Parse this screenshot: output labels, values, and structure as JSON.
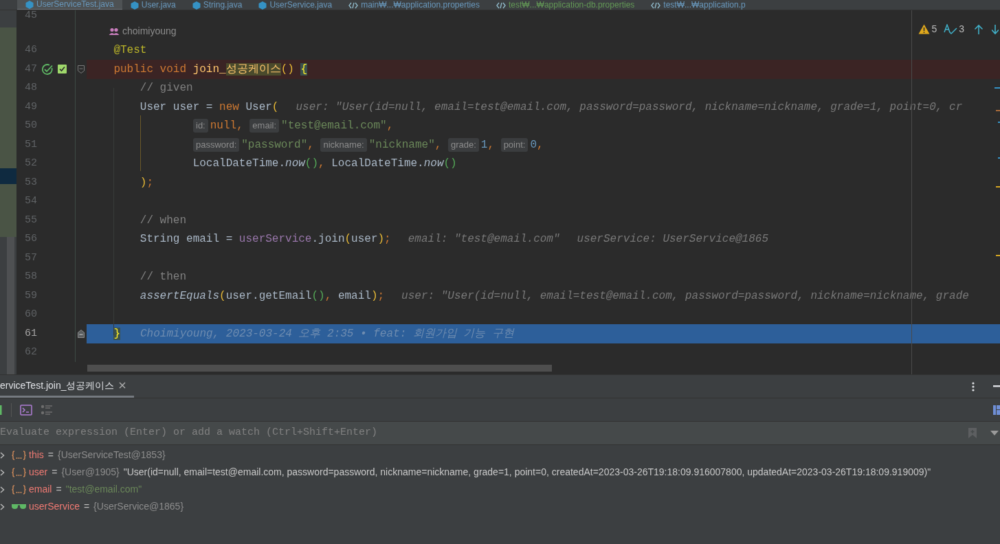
{
  "tabs": [
    {
      "label": "UserServiceTest.java",
      "kind": "java",
      "color": "#6897bb",
      "selected": true
    },
    {
      "label": "User.java",
      "kind": "java",
      "color": "#6897bb",
      "selected": false
    },
    {
      "label": "String.java",
      "kind": "java",
      "color": "#6897bb",
      "selected": false
    },
    {
      "label": "UserService.java",
      "kind": "java",
      "color": "#6897bb",
      "selected": false
    },
    {
      "label": "main₩...₩application.properties",
      "kind": "properties",
      "color": "#6897bb",
      "selected": false
    },
    {
      "label": "test₩...₩application-db.properties",
      "kind": "properties",
      "color": "#629755",
      "selected": false
    },
    {
      "label": "test₩...₩application.p",
      "kind": "properties",
      "color": "#6897bb",
      "selected": false
    }
  ],
  "inspections": {
    "warnings": "5",
    "typos": "3"
  },
  "lines": [
    {
      "kind": "code",
      "number": "45"
    },
    {
      "kind": "author",
      "text": "choimiyoung"
    },
    {
      "kind": "code",
      "number": "46",
      "tokens": [
        {
          "kind": "annotation",
          "text": "    @Test"
        }
      ]
    },
    {
      "kind": "test_header",
      "number": "47",
      "tokens": [
        {
          "kind": "keyword",
          "text": "    public void "
        },
        {
          "kind": "method",
          "text": "join_"
        },
        {
          "kind": "method_hl",
          "text": "성공케이스"
        },
        {
          "kind": "bracket1",
          "text": "() "
        },
        {
          "kind": "brace_match",
          "text": "{"
        }
      ]
    },
    {
      "kind": "code",
      "number": "48",
      "tokens": [
        {
          "kind": "comment",
          "text": "        // given"
        }
      ]
    },
    {
      "kind": "code",
      "number": "49",
      "tokens": [
        {
          "kind": "plain",
          "text": "        User user = "
        },
        {
          "kind": "keyword",
          "text": "new"
        },
        {
          "kind": "plain",
          "text": " User"
        },
        {
          "kind": "bracket1",
          "text": "("
        },
        {
          "kind": "hint",
          "text": "user: \"User(id=null, email=test@email.com, password=password, nickname=nickname, grade=1, point=0, cr"
        }
      ]
    },
    {
      "kind": "code",
      "number": "50",
      "tokens": [
        {
          "kind": "param",
          "text": "id:"
        },
        {
          "kind": "keyword",
          "text": "null"
        },
        {
          "kind": "punct",
          "text": ", "
        },
        {
          "kind": "param",
          "text": "email:"
        },
        {
          "kind": "string",
          "text": "\"test@email.com\""
        },
        {
          "kind": "punct",
          "text": ","
        }
      ]
    },
    {
      "kind": "code",
      "number": "51",
      "tokens": [
        {
          "kind": "param",
          "text": "password:"
        },
        {
          "kind": "string",
          "text": "\"password\""
        },
        {
          "kind": "punct",
          "text": ", "
        },
        {
          "kind": "param",
          "text": "nickname:"
        },
        {
          "kind": "string",
          "text": "\"nickname\""
        },
        {
          "kind": "punct",
          "text": ", "
        },
        {
          "kind": "param",
          "text": "grade:"
        },
        {
          "kind": "number",
          "text": "1"
        },
        {
          "kind": "punct",
          "text": ", "
        },
        {
          "kind": "param",
          "text": "point:"
        },
        {
          "kind": "number",
          "text": "0"
        },
        {
          "kind": "punct",
          "text": ","
        }
      ]
    },
    {
      "kind": "code",
      "number": "52",
      "tokens": [
        {
          "kind": "plain",
          "text": "                LocalDateTime."
        },
        {
          "kind": "static",
          "text": "now"
        },
        {
          "kind": "bracket2",
          "text": "()"
        },
        {
          "kind": "punct",
          "text": ", "
        },
        {
          "kind": "plain",
          "text": "LocalDateTime."
        },
        {
          "kind": "static",
          "text": "now"
        },
        {
          "kind": "bracket2",
          "text": "()"
        }
      ]
    },
    {
      "kind": "code",
      "number": "53",
      "tokens": [
        {
          "kind": "bracket1",
          "text": "        )"
        },
        {
          "kind": "punct",
          "text": ";"
        }
      ]
    },
    {
      "kind": "code",
      "number": "54"
    },
    {
      "kind": "code",
      "number": "55",
      "tokens": [
        {
          "kind": "comment",
          "text": "        // when"
        }
      ]
    },
    {
      "kind": "code",
      "number": "56",
      "tokens": [
        {
          "kind": "plain",
          "text": "        String email = "
        },
        {
          "kind": "field",
          "text": "userService"
        },
        {
          "kind": "plain",
          "text": ".join"
        },
        {
          "kind": "bracket1",
          "text": "("
        },
        {
          "kind": "plain",
          "text": "user"
        },
        {
          "kind": "bracket1",
          "text": ")"
        },
        {
          "kind": "punct",
          "text": ";"
        },
        {
          "kind": "hint",
          "text": "email: \"test@email.com\""
        },
        {
          "kind": "hint",
          "text": "userService: UserService@1865"
        }
      ]
    },
    {
      "kind": "code",
      "number": "57"
    },
    {
      "kind": "code",
      "number": "58",
      "tokens": [
        {
          "kind": "comment",
          "text": "        // then"
        }
      ]
    },
    {
      "kind": "code",
      "number": "59",
      "tokens": [
        {
          "kind": "static",
          "text": "        assertEquals"
        },
        {
          "kind": "bracket1",
          "text": "("
        },
        {
          "kind": "plain",
          "text": "user.getEmail"
        },
        {
          "kind": "bracket2",
          "text": "()"
        },
        {
          "kind": "punct",
          "text": ", "
        },
        {
          "kind": "plain",
          "text": "email"
        },
        {
          "kind": "bracket1",
          "text": ")"
        },
        {
          "kind": "punct",
          "text": ";"
        },
        {
          "kind": "hint",
          "text": "user: \"User(id=null, email=test@email.com, password=password, nickname=nickname, grade"
        }
      ]
    },
    {
      "kind": "code",
      "number": "60"
    },
    {
      "kind": "current_line",
      "number": "61",
      "tokens": [
        {
          "kind": "brace_match",
          "text": "    }"
        },
        {
          "kind": "blame",
          "text": "Choimiyoung, 2023-03-24 오후 2:35 • feat: 회원가입 기능 구현"
        }
      ]
    },
    {
      "kind": "code",
      "number": "62"
    }
  ],
  "debug_panel": {
    "session_tab": {
      "label": "erviceTest.join_성공케이스",
      "selected": true
    },
    "evaluate_placeholder": "Evaluate expression (Enter) or add a watch (Ctrl+Shift+Enter)",
    "variables": [
      {
        "kind": "object",
        "name": "this",
        "sep": "=",
        "ref": "{UserServiceTest@1853}"
      },
      {
        "kind": "object",
        "name": "user",
        "sep": "=",
        "ref": "{User@1905}",
        "text": "\"User(id=null, email=test@email.com, password=password, nickname=nickname, grade=1, point=0, createdAt=2023-03-26T19:18:09.916007800, updatedAt=2023-03-26T19:18:09.919009)\""
      },
      {
        "kind": "object",
        "name": "email",
        "sep": "=",
        "string": "\"test@email.com\""
      },
      {
        "kind": "watch",
        "name": "userService",
        "sep": "=",
        "ref": "{UserService@1865}"
      }
    ]
  }
}
